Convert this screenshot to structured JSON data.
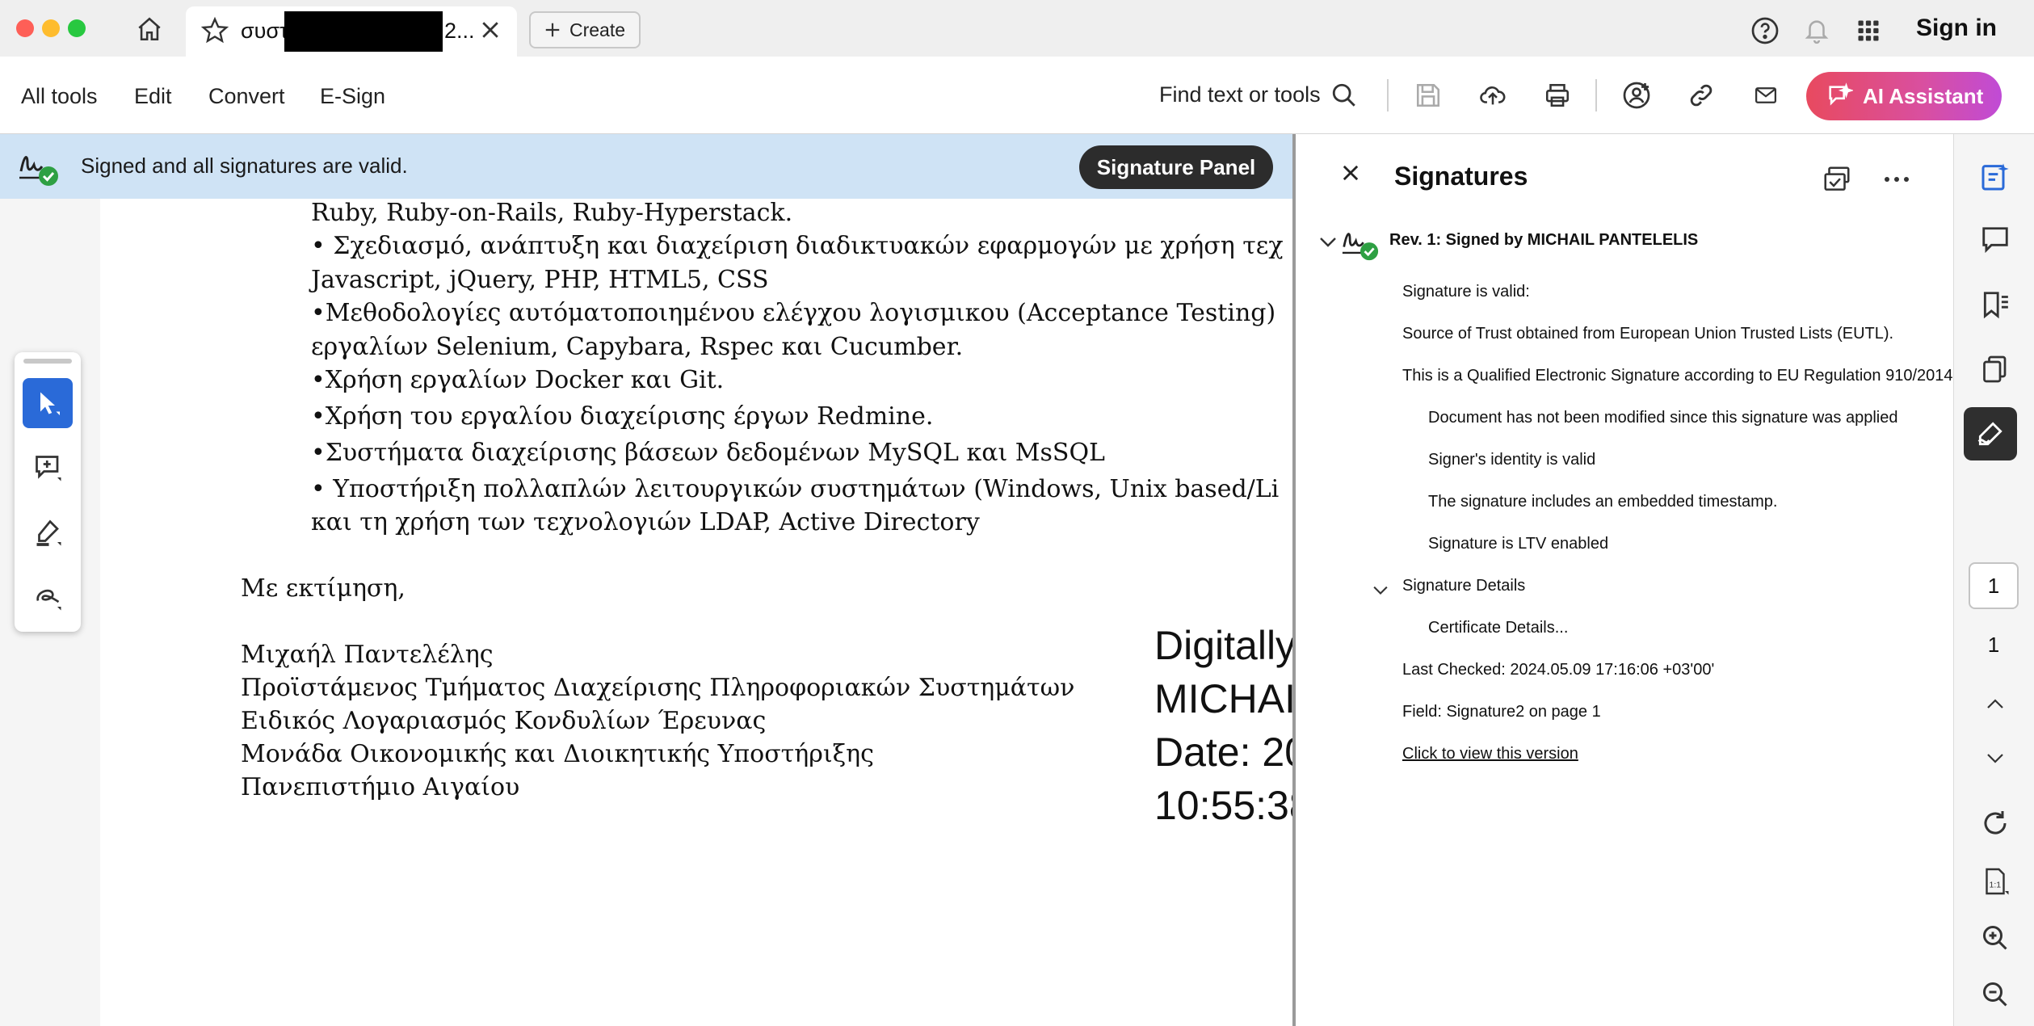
{
  "titlebar": {
    "tab_title": "συστ",
    "tab_title_tail": "2...",
    "create_label": "Create",
    "sign_in_label": "Sign in"
  },
  "menubar": {
    "items": [
      "All tools",
      "Edit",
      "Convert",
      "E-Sign"
    ],
    "find_label": "Find text or tools",
    "ai_label": "AI Assistant"
  },
  "signature_bar": {
    "message": "Signed and all signatures are valid.",
    "panel_button": "Signature Panel"
  },
  "document": {
    "lines": [
      "Ruby, Ruby-on-Rails, Ruby-Hyperstack.",
      "• Σχεδιασμό, ανάπτυξη και διαχείριση διαδικτυακών εφαρμογών με χρήση τεχ",
      "Javascript, jQuery, PHP, HTML5, CSS",
      "•Μεθοδολογίες αυτόματοποιημένου ελέγχου λογισμικου (Acceptance Testing)",
      "εργαλίων Selenium, Capybara, Rspec και Cucumber.",
      "•Χρήση εργαλίων Docker και Git.",
      "•Χρήση του εργαλίου διαχείρισης έργων Redmine.",
      "•Συστήματα διαχείρισης βάσεων δεδομένων MySQL και  MsSQL",
      "• Υποστήριξη πολλαπλών λειτουργικών συστημάτων (Windows, Unix based/Li",
      "και τη χρήση των τεχνολογιών LDAP, Active Directory"
    ],
    "closing": "Με εκτίμηση,",
    "signature_lines": [
      "Μιχαήλ Παντελέλης",
      "Προϊστάμενος Τμήματος Διαχείρισης Πληροφοριακών Συστημάτων",
      "Ειδικός Λογαριασμός Κονδυλίων Έρευνας",
      "Μονάδα Οικονομικής και Διοικητικής Υποστήριξης",
      "Πανεπιστήμιο Αιγαίου"
    ],
    "stamp_lines": [
      "Digitally",
      "MICHAI",
      "Date: 20",
      "10:55:38"
    ]
  },
  "signatures_panel": {
    "title": "Signatures",
    "revision": "Rev. 1: Signed by MICHAIL PANTELELIS",
    "valid": "Signature is valid:",
    "source_trust": "Source of Trust obtained from European Union Trusted Lists (EUTL).",
    "qualified": "This is a Qualified Electronic Signature according to EU Regulation 910/2014",
    "not_modified": "Document has not been modified since this signature was applied",
    "identity_valid": "Signer's identity is valid",
    "timestamp": "The signature includes an embedded timestamp.",
    "ltv": "Signature is LTV enabled",
    "details_label": "Signature Details",
    "certificate_details": "Certificate Details...",
    "last_checked": "Last Checked: 2024.05.09 17:16:06 +03'00'",
    "field": "Field: Signature2 on page 1",
    "view_version": "Click to view this version"
  },
  "right_rail": {
    "current_page": "1",
    "total_pages": "1"
  },
  "colors": {
    "accent_blue": "#2a6ad8",
    "signature_bar": "#cfe3f5",
    "valid_green": "#2ea043"
  }
}
